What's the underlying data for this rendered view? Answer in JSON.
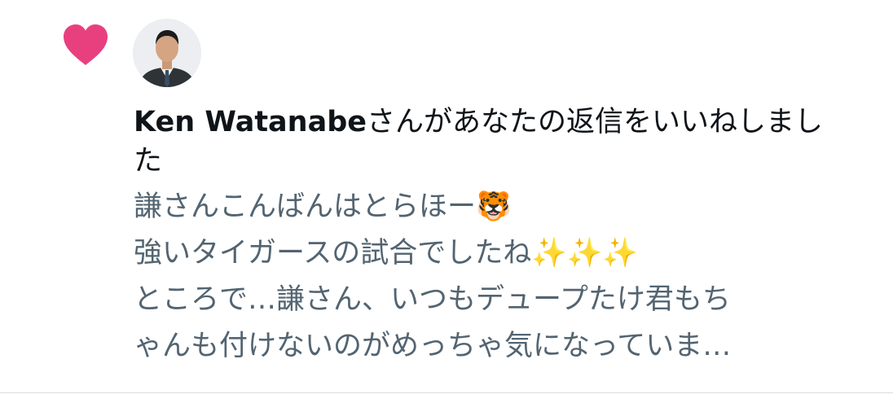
{
  "notification": {
    "type_icon": "heart-icon",
    "accent_color": "#e8407f",
    "actor": {
      "name": "Ken Watanabe",
      "avatar_icon": "avatar-photo"
    },
    "action_text": "さんがあなたの返信をいいねしました",
    "tweet_lines": [
      "謙さんこんばんはとらほー🐯",
      "強いタイガースの試合でしたね✨✨✨",
      "ところで…謙さん、いつもデュープたけ君もち",
      "ゃんも付けないのがめっちゃ気になっていま…"
    ]
  }
}
